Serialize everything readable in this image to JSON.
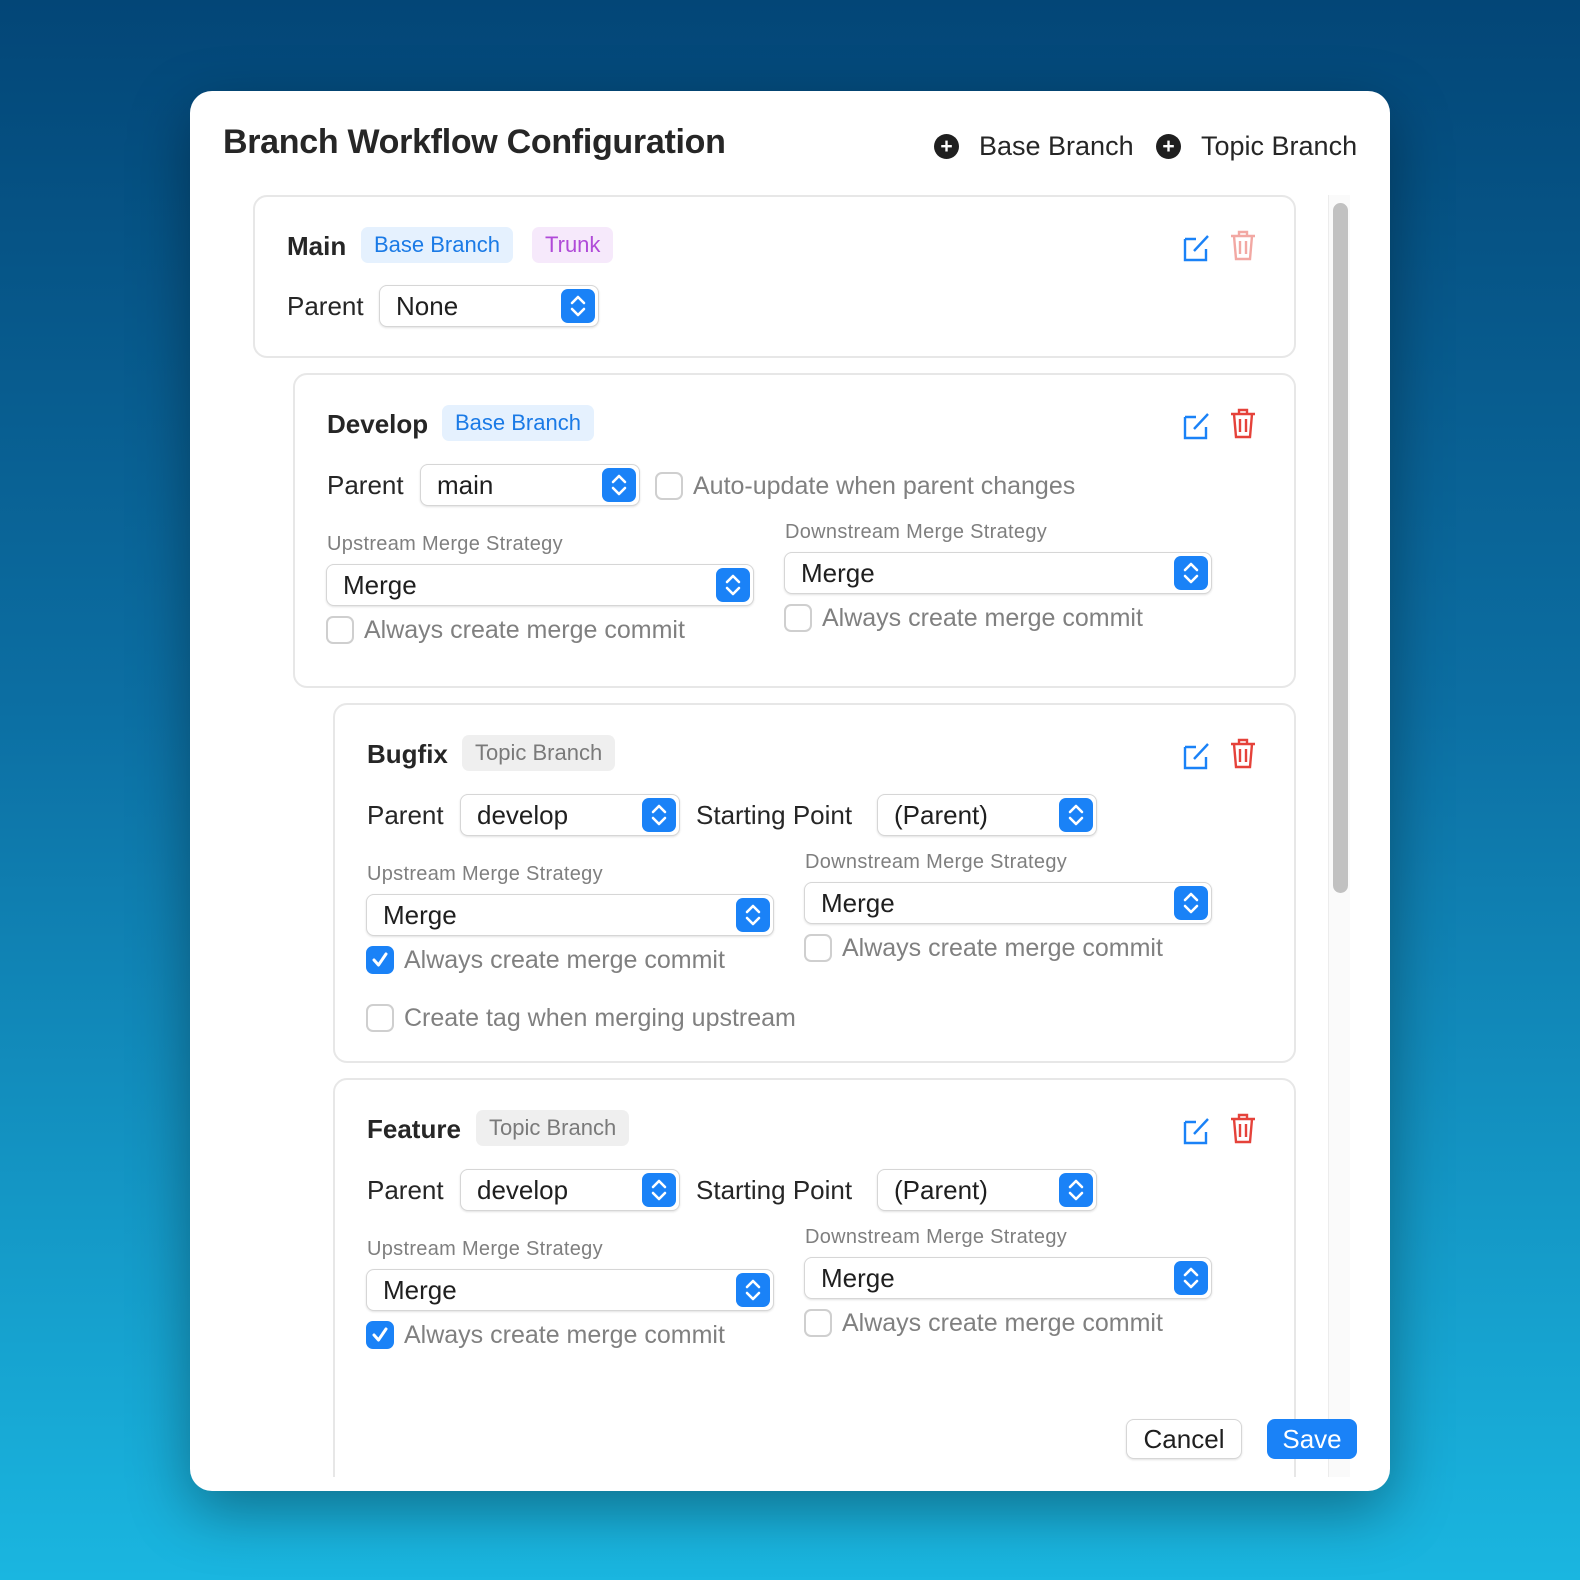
{
  "dialog": {
    "title": "Branch Workflow Configuration",
    "add_base_label": "Base Branch",
    "add_topic_label": "Topic Branch",
    "cancel_label": "Cancel",
    "save_label": "Save"
  },
  "labels": {
    "parent": "Parent",
    "starting_point": "Starting Point",
    "upstream": "Upstream Merge Strategy",
    "downstream": "Downstream Merge Strategy",
    "always_merge_commit": "Always create merge commit",
    "auto_update": "Auto-update when parent changes",
    "create_tag": "Create tag when merging upstream"
  },
  "branches": [
    {
      "name": "Main",
      "badges": [
        "Base Branch",
        "Trunk"
      ],
      "parent": "None"
    },
    {
      "name": "Develop",
      "badges": [
        "Base Branch"
      ],
      "parent": "main",
      "auto_update": false,
      "upstream_strategy": "Merge",
      "upstream_always_merge": false,
      "downstream_strategy": "Merge",
      "downstream_always_merge": false
    },
    {
      "name": "Bugfix",
      "badges": [
        "Topic Branch"
      ],
      "parent": "develop",
      "starting_point": "(Parent)",
      "upstream_strategy": "Merge",
      "upstream_always_merge": true,
      "downstream_strategy": "Merge",
      "downstream_always_merge": false,
      "create_tag": false
    },
    {
      "name": "Feature",
      "badges": [
        "Topic Branch"
      ],
      "parent": "develop",
      "starting_point": "(Parent)",
      "upstream_strategy": "Merge",
      "upstream_always_merge": true,
      "downstream_strategy": "Merge",
      "downstream_always_merge": false
    }
  ],
  "colors": {
    "accent": "#1a82f7",
    "delete": "#e5423a",
    "delete_disabled": "#f2a8a3"
  }
}
